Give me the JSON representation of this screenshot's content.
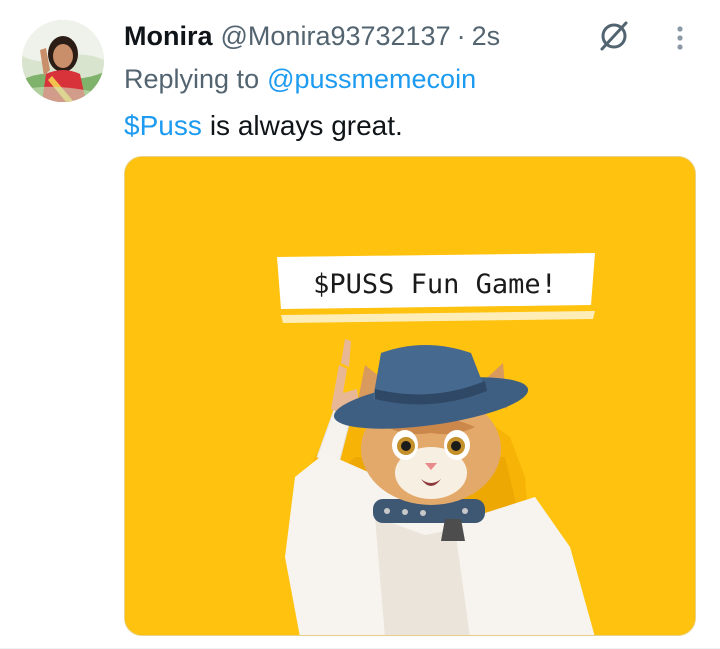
{
  "tweet": {
    "display_name": "Monira",
    "handle": "@Monira93732137",
    "separator": "·",
    "timestamp": "2s",
    "replying_prefix": "Replying to",
    "replying_to": "@pussmemecoin",
    "cashtag": "$Puss",
    "body_rest": "is always great.",
    "media": {
      "banner_text": "$PUSS Fun Game!",
      "background_color": "#ffc20e"
    }
  },
  "icons": {
    "grok": "grok-icon",
    "more": "more-vertical-icon"
  },
  "colors": {
    "link": "#1d9bf0",
    "text_primary": "#0f1419",
    "text_secondary": "#536471"
  }
}
